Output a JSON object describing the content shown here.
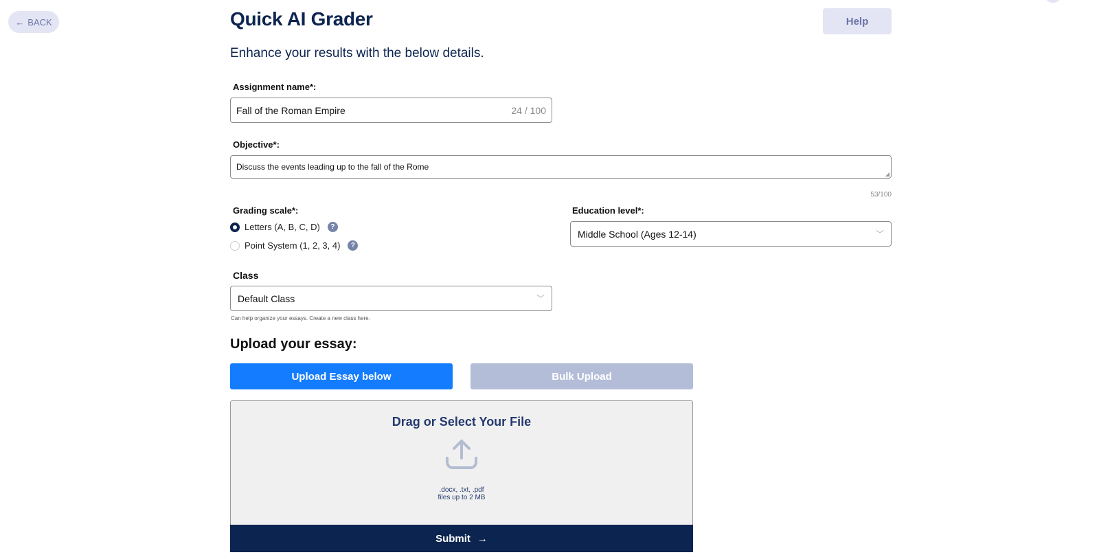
{
  "nav": {
    "back_label": "BACK",
    "help_label": "Help"
  },
  "header": {
    "title": "Quick AI Grader",
    "subtitle": "Enhance your results with the below details."
  },
  "form": {
    "assignment": {
      "label": "Assignment name*:",
      "value": "Fall of the Roman Empire",
      "counter": "24 / 100"
    },
    "objective": {
      "label": "Objective*:",
      "value": "Discuss the events leading up to the fall of the Rome",
      "counter": "53/100"
    },
    "grading": {
      "label": "Grading scale*:",
      "options": [
        {
          "label": "Letters (A, B, C, D)",
          "selected": true
        },
        {
          "label": "Point System (1, 2, 3, 4)",
          "selected": false
        }
      ]
    },
    "education": {
      "label": "Education level*:",
      "value": "Middle School (Ages 12-14)"
    },
    "class": {
      "label": "Class",
      "value": "Default Class",
      "hint": "Can help organize your essays. Create a new class here."
    }
  },
  "upload": {
    "heading": "Upload your essay:",
    "tab_single": "Upload Essay below",
    "tab_bulk": "Bulk Upload",
    "drop_title": "Drag or Select Your File",
    "formats": ".docx, .txt, .pdf",
    "size_limit": "files up to 2 MB",
    "submit_label": "Submit"
  },
  "colors": {
    "primary": "#0c2450",
    "accent": "#147cff",
    "disabled": "#b4bdd8"
  }
}
